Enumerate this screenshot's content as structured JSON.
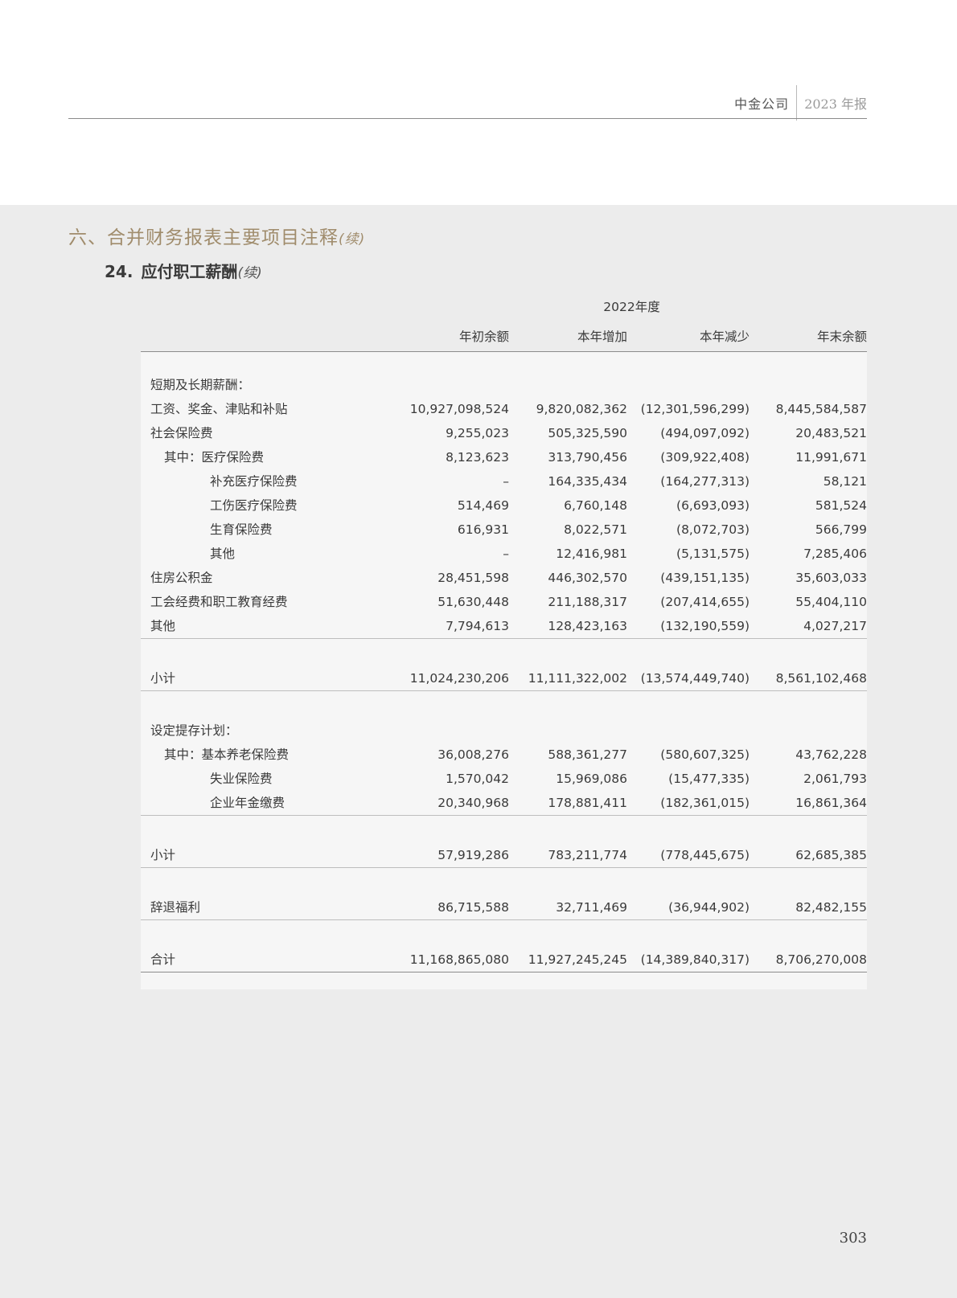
{
  "running_head": {
    "company": "中金公司",
    "year": "2023 年报"
  },
  "section_title": "六、合并财务报表主要项目注释",
  "continued": "(续)",
  "subsection": {
    "number": "24.",
    "title": "应付职工薪酬"
  },
  "table": {
    "period": "2022年度",
    "columns": [
      "年初余额",
      "本年增加",
      "本年减少",
      "年末余额"
    ],
    "group1_title": "短期及长期薪酬：",
    "group1_rows": [
      {
        "label": "工资、奖金、津贴和补贴",
        "v": [
          "10,927,098,524",
          "9,820,082,362",
          "(12,301,596,299)",
          "8,445,584,587"
        ]
      },
      {
        "label": "社会保险费",
        "v": [
          "9,255,023",
          "505,325,590",
          "(494,097,092)",
          "20,483,521"
        ]
      },
      {
        "label": "其中：医疗保险费",
        "v": [
          "8,123,623",
          "313,790,456",
          "(309,922,408)",
          "11,991,671"
        ]
      },
      {
        "label": "补充医疗保险费",
        "v": [
          "–",
          "164,335,434",
          "(164,277,313)",
          "58,121"
        ]
      },
      {
        "label": "工伤医疗保险费",
        "v": [
          "514,469",
          "6,760,148",
          "(6,693,093)",
          "581,524"
        ]
      },
      {
        "label": "生育保险费",
        "v": [
          "616,931",
          "8,022,571",
          "(8,072,703)",
          "566,799"
        ]
      },
      {
        "label": "其他",
        "v": [
          "–",
          "12,416,981",
          "(5,131,575)",
          "7,285,406"
        ]
      },
      {
        "label": "住房公积金",
        "v": [
          "28,451,598",
          "446,302,570",
          "(439,151,135)",
          "35,603,033"
        ]
      },
      {
        "label": "工会经费和职工教育经费",
        "v": [
          "51,630,448",
          "211,188,317",
          "(207,414,655)",
          "55,404,110"
        ]
      },
      {
        "label": "其他",
        "v": [
          "7,794,613",
          "128,423,163",
          "(132,190,559)",
          "4,027,217"
        ]
      }
    ],
    "subtotal1": {
      "label": "小计",
      "v": [
        "11,024,230,206",
        "11,111,322,002",
        "(13,574,449,740)",
        "8,561,102,468"
      ]
    },
    "group2_title": "设定提存计划：",
    "group2_rows": [
      {
        "label": "其中：基本养老保险费",
        "v": [
          "36,008,276",
          "588,361,277",
          "(580,607,325)",
          "43,762,228"
        ]
      },
      {
        "label": "失业保险费",
        "v": [
          "1,570,042",
          "15,969,086",
          "(15,477,335)",
          "2,061,793"
        ]
      },
      {
        "label": "企业年金缴费",
        "v": [
          "20,340,968",
          "178,881,411",
          "(182,361,015)",
          "16,861,364"
        ]
      }
    ],
    "subtotal2": {
      "label": "小计",
      "v": [
        "57,919,286",
        "783,211,774",
        "(778,445,675)",
        "62,685,385"
      ]
    },
    "termination": {
      "label": "辞退福利",
      "v": [
        "86,715,588",
        "32,711,469",
        "(36,944,902)",
        "82,482,155"
      ]
    },
    "total": {
      "label": "合计",
      "v": [
        "11,168,865,080",
        "11,927,245,245",
        "(14,389,840,317)",
        "8,706,270,008"
      ]
    }
  },
  "page_number": "303"
}
